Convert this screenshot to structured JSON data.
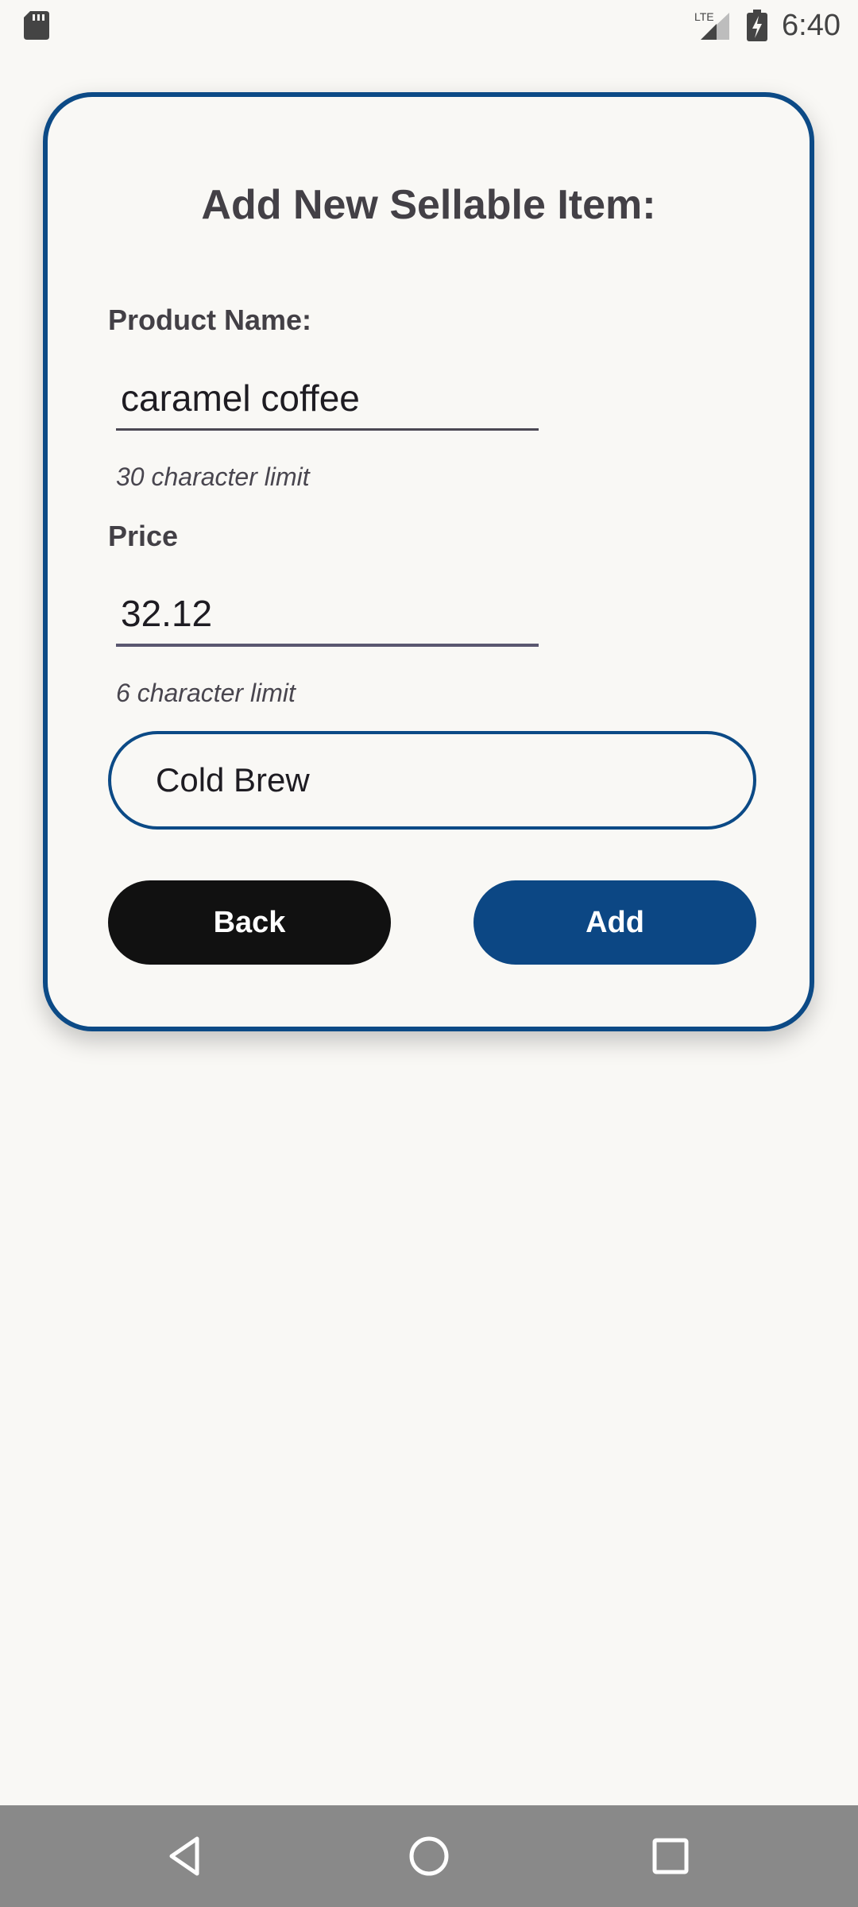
{
  "status_bar": {
    "time": "6:40",
    "network_label": "LTE",
    "icons": [
      "sd-card-icon",
      "lte-signal-icon",
      "battery-charging-icon"
    ]
  },
  "form": {
    "title": "Add New Sellable Item:",
    "product_name": {
      "label": "Product Name:",
      "value": "caramel coffee",
      "helper": "30 character limit"
    },
    "price": {
      "label": "Price",
      "value": "32.12",
      "helper": "6 character limit"
    },
    "category_select": {
      "selected": "Cold Brew"
    },
    "buttons": {
      "back": "Back",
      "add": "Add"
    }
  },
  "nav_bar": {
    "icons": [
      "back-triangle-icon",
      "home-circle-icon",
      "recents-square-icon"
    ]
  },
  "colors": {
    "accent": "#0c4a86",
    "background": "#f9f8f5",
    "back_button": "#111111",
    "add_button": "#0c4784",
    "nav_bar": "#898989"
  }
}
